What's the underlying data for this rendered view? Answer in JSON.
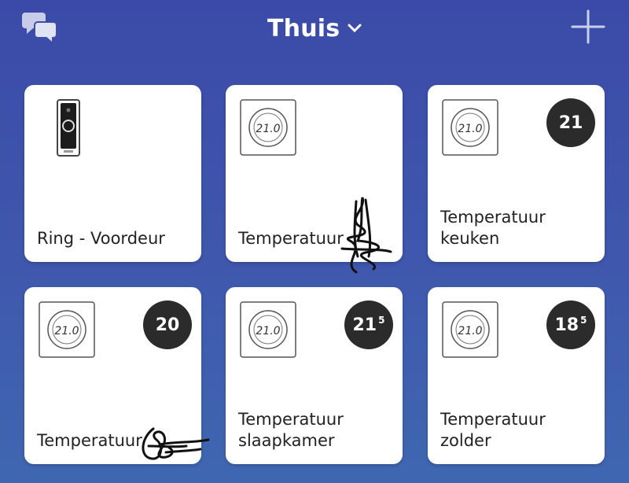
{
  "header": {
    "title": "Thuis",
    "icons": {
      "left": "chat-bubbles-icon",
      "title_dropdown": "chevron-down-icon",
      "right": "plus-icon"
    }
  },
  "tiles": [
    {
      "label": "Ring - Voordeur",
      "icon": "doorbell-icon",
      "badge": null
    },
    {
      "label": "Temperatuur",
      "icon": "thermostat-icon",
      "badge": null
    },
    {
      "label": "Temperatuur\nkeuken",
      "icon": "thermostat-icon",
      "badge": {
        "value": "21",
        "sup": ""
      }
    },
    {
      "label": "Temperatuur",
      "icon": "thermostat-icon",
      "badge": {
        "value": "20",
        "sup": ""
      }
    },
    {
      "label": "Temperatuur\nslaapkamer",
      "icon": "thermostat-icon",
      "badge": {
        "value": "21",
        "sup": "5"
      }
    },
    {
      "label": "Temperatuur\nzolder",
      "icon": "thermostat-icon",
      "badge": {
        "value": "18",
        "sup": "5"
      }
    }
  ],
  "thermostat_display": "21.0",
  "colors": {
    "background_top": "#3b4aa8",
    "background_bottom": "#3f67b0",
    "tile": "#ffffff",
    "badge": "#2b2b2b"
  }
}
